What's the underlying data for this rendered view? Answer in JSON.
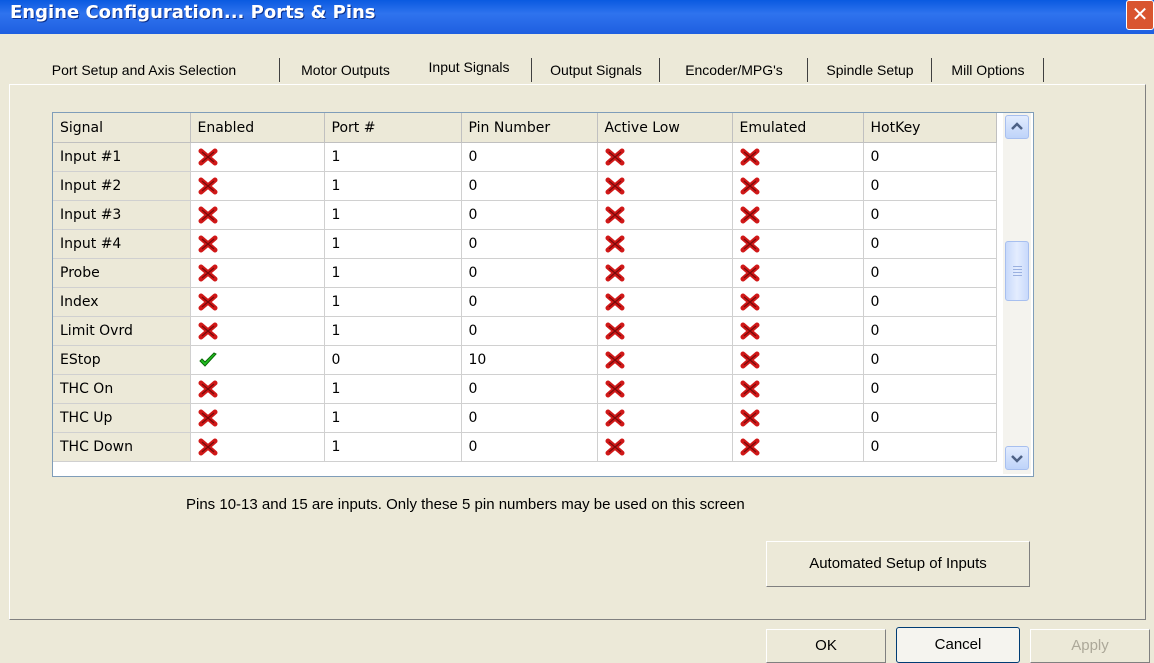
{
  "window": {
    "title": "Engine Configuration... Ports & Pins",
    "close_glyph": "✕"
  },
  "tabs": [
    {
      "label": "Port Setup and Axis Selection",
      "active": false
    },
    {
      "label": "Motor Outputs",
      "active": false
    },
    {
      "label": "Input Signals",
      "active": true
    },
    {
      "label": "Output Signals",
      "active": false
    },
    {
      "label": "Encoder/MPG's",
      "active": false
    },
    {
      "label": "Spindle Setup",
      "active": false
    },
    {
      "label": "Mill Options",
      "active": false
    }
  ],
  "table": {
    "headers": [
      "Signal",
      "Enabled",
      "Port #",
      "Pin Number",
      "Active Low",
      "Emulated",
      "HotKey"
    ],
    "rows": [
      {
        "signal": "Input #1",
        "enabled": false,
        "port": "1",
        "pin": "0",
        "active_low": false,
        "emulated": false,
        "hotkey": "0"
      },
      {
        "signal": "Input #2",
        "enabled": false,
        "port": "1",
        "pin": "0",
        "active_low": false,
        "emulated": false,
        "hotkey": "0"
      },
      {
        "signal": "Input #3",
        "enabled": false,
        "port": "1",
        "pin": "0",
        "active_low": false,
        "emulated": false,
        "hotkey": "0"
      },
      {
        "signal": "Input #4",
        "enabled": false,
        "port": "1",
        "pin": "0",
        "active_low": false,
        "emulated": false,
        "hotkey": "0"
      },
      {
        "signal": "Probe",
        "enabled": false,
        "port": "1",
        "pin": "0",
        "active_low": false,
        "emulated": false,
        "hotkey": "0"
      },
      {
        "signal": "Index",
        "enabled": false,
        "port": "1",
        "pin": "0",
        "active_low": false,
        "emulated": false,
        "hotkey": "0"
      },
      {
        "signal": "Limit Ovrd",
        "enabled": false,
        "port": "1",
        "pin": "0",
        "active_low": false,
        "emulated": false,
        "hotkey": "0"
      },
      {
        "signal": "EStop",
        "enabled": true,
        "port": "0",
        "pin": "10",
        "active_low": false,
        "emulated": false,
        "hotkey": "0"
      },
      {
        "signal": "THC On",
        "enabled": false,
        "port": "1",
        "pin": "0",
        "active_low": false,
        "emulated": false,
        "hotkey": "0"
      },
      {
        "signal": "THC Up",
        "enabled": false,
        "port": "1",
        "pin": "0",
        "active_low": false,
        "emulated": false,
        "hotkey": "0"
      },
      {
        "signal": "THC Down",
        "enabled": false,
        "port": "1",
        "pin": "0",
        "active_low": false,
        "emulated": false,
        "hotkey": "0"
      }
    ]
  },
  "note": "Pins 10-13 and 15 are inputs. Only these 5 pin numbers may be used on this screen",
  "buttons": {
    "automated_setup": "Automated Setup of Inputs",
    "ok": "OK",
    "cancel": "Cancel",
    "apply": "Apply"
  },
  "icons": {
    "true_icon": "green-check-icon",
    "false_icon": "red-x-icon",
    "true_color": "#22C020",
    "false_color": "#D01818"
  }
}
